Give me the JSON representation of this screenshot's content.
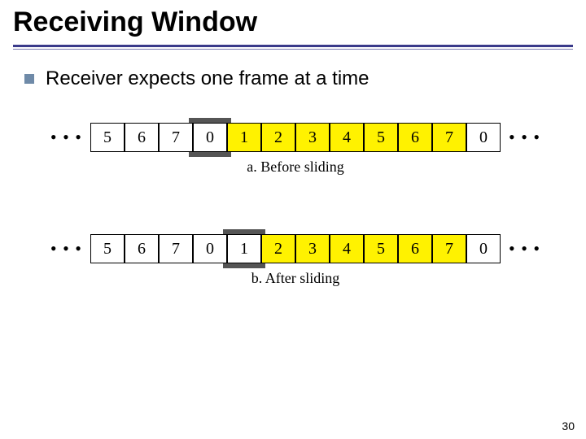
{
  "title": "Receiving Window",
  "bullet": "Receiver expects one frame at a time",
  "dots": "• • •",
  "rowA": {
    "cells": [
      {
        "v": "5",
        "y": false
      },
      {
        "v": "6",
        "y": false
      },
      {
        "v": "7",
        "y": false
      },
      {
        "v": "0",
        "y": false
      },
      {
        "v": "1",
        "y": true
      },
      {
        "v": "2",
        "y": true
      },
      {
        "v": "3",
        "y": true
      },
      {
        "v": "4",
        "y": true
      },
      {
        "v": "5",
        "y": true
      },
      {
        "v": "6",
        "y": true
      },
      {
        "v": "7",
        "y": true
      },
      {
        "v": "0",
        "y": false
      }
    ],
    "markerIndex": 3,
    "caption": "a. Before sliding"
  },
  "rowB": {
    "cells": [
      {
        "v": "5",
        "y": false
      },
      {
        "v": "6",
        "y": false
      },
      {
        "v": "7",
        "y": false
      },
      {
        "v": "0",
        "y": false
      },
      {
        "v": "1",
        "y": false
      },
      {
        "v": "2",
        "y": true
      },
      {
        "v": "3",
        "y": true
      },
      {
        "v": "4",
        "y": true
      },
      {
        "v": "5",
        "y": true
      },
      {
        "v": "6",
        "y": true
      },
      {
        "v": "7",
        "y": true
      },
      {
        "v": "0",
        "y": false
      }
    ],
    "markerIndex": 4,
    "caption": "b. After sliding"
  },
  "pageNumber": "30"
}
